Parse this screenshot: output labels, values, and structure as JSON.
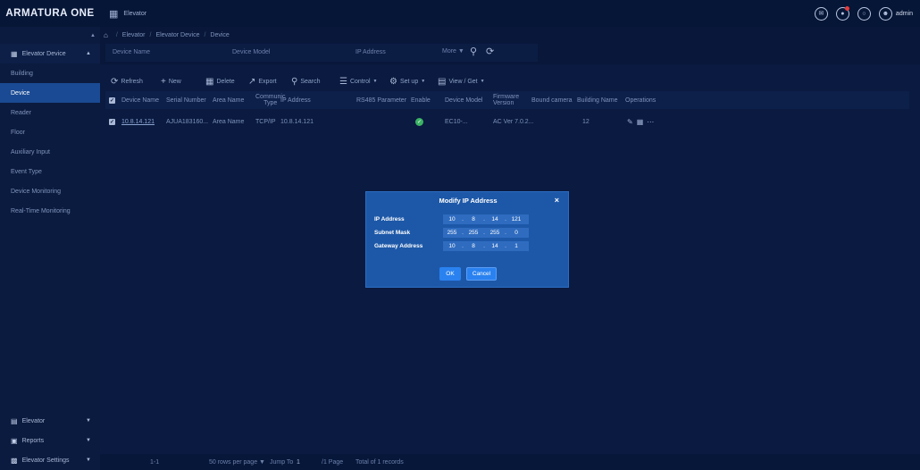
{
  "app": {
    "logo": "ARMATURA ONE",
    "module": "Elevator",
    "user": "admin"
  },
  "breadcrumb": [
    "Elevator",
    "Elevator Device",
    "Device"
  ],
  "sidebar": {
    "group_title": "Elevator Device",
    "items": [
      {
        "label": "Building"
      },
      {
        "label": "Device",
        "active": true
      },
      {
        "label": "Reader"
      },
      {
        "label": "Floor"
      },
      {
        "label": "Auxiliary Input"
      },
      {
        "label": "Event Type"
      },
      {
        "label": "Device Monitoring"
      },
      {
        "label": "Real-Time Monitoring"
      }
    ],
    "bottom": [
      {
        "label": "Elevator"
      },
      {
        "label": "Reports"
      },
      {
        "label": "Elevator Settings"
      }
    ]
  },
  "filters": {
    "device_name": "Device Name",
    "device_model": "Device Model",
    "ip_address": "IP Address",
    "more": "More"
  },
  "toolbar": {
    "refresh": "Refresh",
    "new": "New",
    "delete": "Delete",
    "export": "Export",
    "search": "Search",
    "control": "Control",
    "setup": "Set up",
    "view_get": "View / Get"
  },
  "table": {
    "headers": {
      "device_name": "Device Name",
      "serial": "Serial Number",
      "area": "Area Name",
      "comm_type_1": "Communic",
      "comm_type_2": "Type",
      "ip": "IP Address",
      "rs485": "RS485 Parameter",
      "enable": "Enable",
      "model": "Device Model",
      "firmware_1": "Firmware",
      "firmware_2": "Version",
      "bound_camera": "Bound camera",
      "building": "Building Name",
      "operations": "Operations"
    },
    "rows": [
      {
        "device_name": "10.8.14.121",
        "serial": "AJUA183160...",
        "area": "Area Name",
        "comm_type": "TCP/IP",
        "ip": "10.8.14.121",
        "rs485": "",
        "enable": true,
        "model": "EC10-...",
        "firmware": "AC Ver 7.0.2...",
        "bound_camera": "",
        "building": "12"
      }
    ]
  },
  "footer": {
    "range": "1-1",
    "per_page": "50 rows per page",
    "jump_label": "Jump To",
    "jump_value": "1",
    "pages": "/1 Page",
    "total": "Total of 1 records"
  },
  "modal": {
    "title": "Modify IP Address",
    "ip_label": "IP Address",
    "ip": [
      "10",
      "8",
      "14",
      "121"
    ],
    "mask_label": "Subnet Mask",
    "mask": [
      "255",
      "255",
      "255",
      "0"
    ],
    "gateway_label": "Gateway Address",
    "gateway": [
      "10",
      "8",
      "14",
      "1"
    ],
    "ok": "OK",
    "cancel": "Cancel"
  },
  "colors": {
    "background": "#08173a",
    "sidebar_active": "#1a4a93",
    "modal": "#1d58a8",
    "button": "#2a82f0",
    "enable_green": "#3bb264"
  }
}
